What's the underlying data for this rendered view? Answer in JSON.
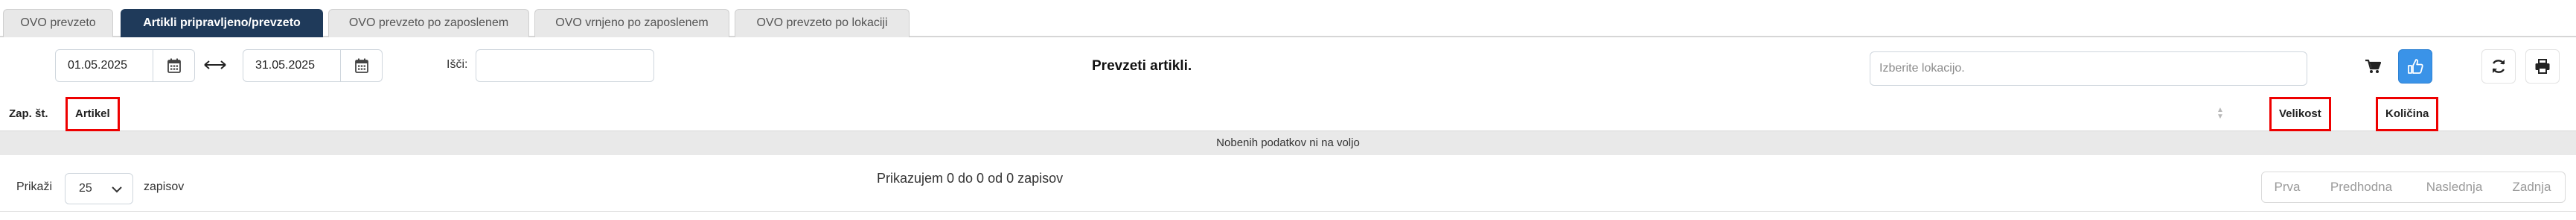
{
  "tabs": [
    {
      "label": "OVO prevzeto",
      "active": false
    },
    {
      "label": "Artikli pripravljeno/prevzeto",
      "active": true
    },
    {
      "label": "OVO prevzeto po zaposlenem",
      "active": false
    },
    {
      "label": "OVO vrnjeno po zaposlenem",
      "active": false
    },
    {
      "label": "OVO prevzeto po lokaciji",
      "active": false
    }
  ],
  "filters": {
    "date_from": "01.05.2025",
    "date_to": "31.05.2025",
    "search_label": "Išči:",
    "search_value": "",
    "location_placeholder": "Izberite lokacijo."
  },
  "page_title": "Prevzeti artikli.",
  "icons": {
    "calendar": "calendar-icon",
    "range": "double-arrow-icon",
    "cart": "shopping-cart-icon",
    "thumbs": "thumbs-up-icon",
    "refresh": "refresh-icon",
    "print": "print-icon"
  },
  "colors": {
    "active_tab": "#1f3a5a",
    "primary_button": "#3a93e8",
    "highlight_box": "#ee0000"
  },
  "table": {
    "columns": [
      "Zap. št.",
      "Artikel",
      "Velikost",
      "Količina"
    ],
    "empty_message": "Nobenih podatkov ni na voljo"
  },
  "footer": {
    "show_label": "Prikaži",
    "page_size": "25",
    "records_label": "zapisov",
    "info": "Prikazujem 0 do 0 od 0 zapisov",
    "pager": [
      "Prva",
      "Predhodna",
      "Naslednja",
      "Zadnja"
    ]
  }
}
